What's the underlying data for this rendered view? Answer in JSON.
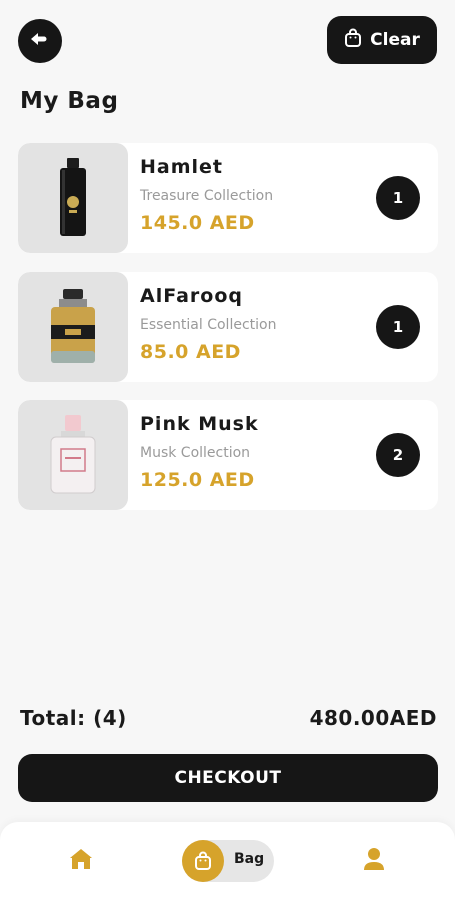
{
  "header": {
    "back_icon": "back-arrow-icon",
    "clear_label": "Clear",
    "clear_icon": "bag-icon"
  },
  "page": {
    "title": "My Bag"
  },
  "cart": {
    "items": [
      {
        "name": "Hamlet",
        "collection": "Treasure Collection",
        "price": "145.0 AED",
        "quantity": "1"
      },
      {
        "name": "AlFarooq",
        "collection": "Essential Collection",
        "price": "85.0 AED",
        "quantity": "1"
      },
      {
        "name": "Pink Musk",
        "collection": "Musk Collection",
        "price": "125.0 AED",
        "quantity": "2"
      }
    ],
    "total_label": "Total: (4)",
    "total_amount": "480.00AED",
    "checkout_label": "CHECKOUT"
  },
  "bottom_nav": {
    "home_icon": "home-icon",
    "bag_icon": "bag-icon",
    "bag_label": "Bag",
    "profile_icon": "profile-icon",
    "active": "Bag"
  },
  "colors": {
    "accent": "#d6a32b",
    "dark": "#161616",
    "background": "#f7f7f7"
  }
}
